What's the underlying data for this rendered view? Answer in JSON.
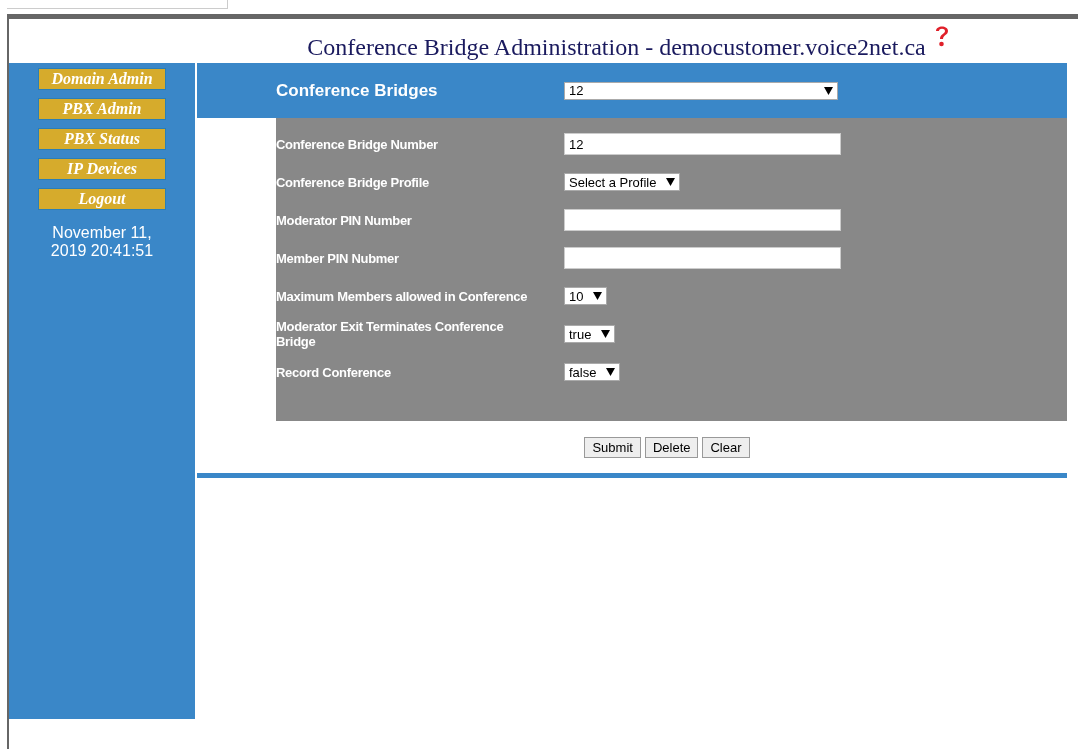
{
  "title": "Conference Bridge Administration - democustomer.voice2net.ca",
  "sidebar": {
    "items": [
      {
        "label": "Domain Admin"
      },
      {
        "label": "PBX Admin"
      },
      {
        "label": "PBX Status"
      },
      {
        "label": "IP Devices"
      },
      {
        "label": "Logout"
      }
    ],
    "datetime": "November 11, 2019 20:41:51"
  },
  "header": {
    "label": "Conference Bridges",
    "select": "12"
  },
  "fields": [
    {
      "label": "Conference Bridge Number",
      "kind": "text",
      "value": "12"
    },
    {
      "label": "Conference Bridge Profile",
      "kind": "select",
      "value": "Select a Profile"
    },
    {
      "label": "Moderator PIN Number",
      "kind": "text"
    },
    {
      "label": "Member PIN Nubmer",
      "kind": "text"
    },
    {
      "label": "Maximum Members allowed in Conference",
      "kind": "select",
      "value": "10"
    },
    {
      "label": "Moderator Exit Terminates Conference Bridge",
      "kind": "select",
      "value": "true"
    },
    {
      "label": "Record Conference",
      "kind": "select",
      "value": "false"
    }
  ],
  "buttons": [
    "Submit",
    "Delete",
    "Clear"
  ]
}
